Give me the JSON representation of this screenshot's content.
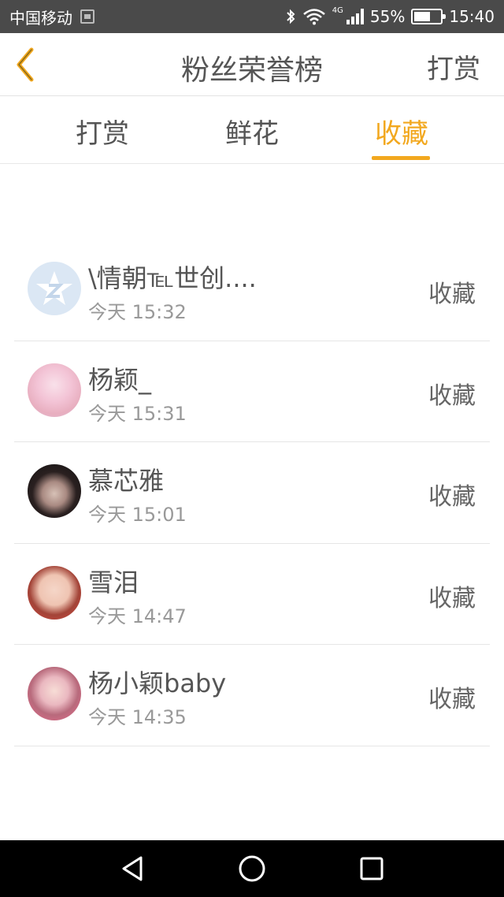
{
  "status_bar": {
    "carrier": "中国移动",
    "network": "4G",
    "battery": "55%",
    "time": "15:40"
  },
  "header": {
    "back_icon": "chevron-left-icon",
    "title": "粉丝荣誉榜",
    "action": "打赏"
  },
  "tabs": [
    {
      "label": "打赏",
      "active": false
    },
    {
      "label": "鲜花",
      "active": false
    },
    {
      "label": "收藏",
      "active": true
    }
  ],
  "colors": {
    "accent": "#f2a81f",
    "status_bar_bg": "#4a4a4a",
    "nav_bar_bg": "#000000"
  },
  "list": [
    {
      "name": "\\情朝℡世创....",
      "time": "今天 15:32",
      "action": "收藏",
      "avatar": "default-avatar"
    },
    {
      "name": "杨颖_",
      "time": "今天 15:31",
      "action": "收藏",
      "avatar": "photo-avatar"
    },
    {
      "name": "慕芯雅",
      "time": "今天 15:01",
      "action": "收藏",
      "avatar": "photo-avatar"
    },
    {
      "name": "雪泪",
      "time": "今天 14:47",
      "action": "收藏",
      "avatar": "photo-avatar"
    },
    {
      "name": "杨小颖baby",
      "time": "今天 14:35",
      "action": "收藏",
      "avatar": "photo-avatar"
    }
  ]
}
